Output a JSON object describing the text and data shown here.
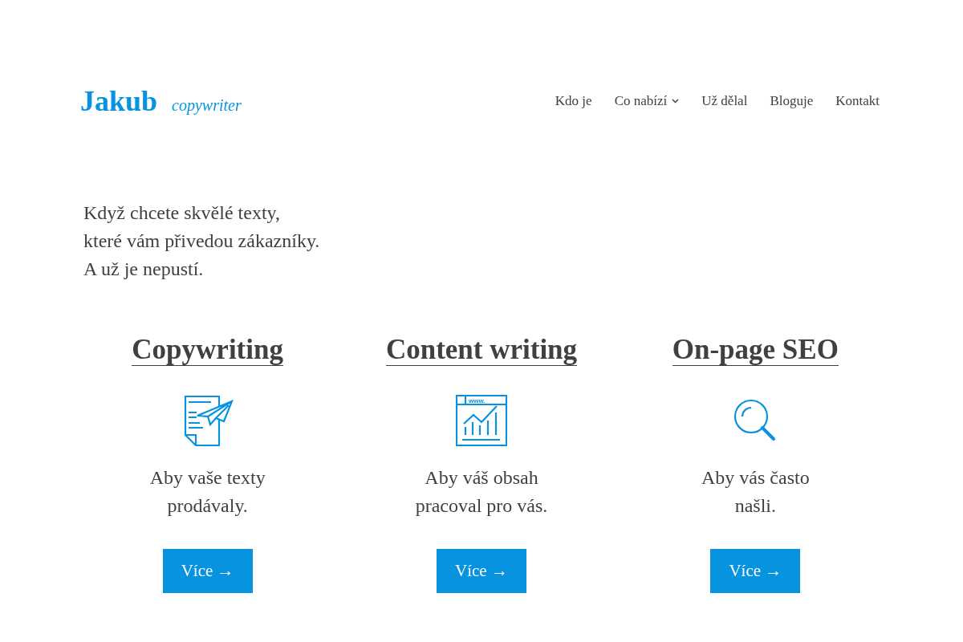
{
  "header": {
    "logo": "Jakub",
    "tagline": "copywriter",
    "nav": [
      {
        "label": "Kdo je",
        "has_dropdown": false
      },
      {
        "label": "Co nabízí",
        "has_dropdown": true
      },
      {
        "label": "Už dělal",
        "has_dropdown": false
      },
      {
        "label": "Bloguje",
        "has_dropdown": false
      },
      {
        "label": "Kontakt",
        "has_dropdown": false
      }
    ]
  },
  "hero": {
    "lines": [
      "Když chcete skvělé texty,",
      "které vám přivedou zákazníky.",
      "A už je nepustí."
    ]
  },
  "services": [
    {
      "title": "Copywriting",
      "kind": "document",
      "description": [
        "Aby vaše texty",
        "prodávaly."
      ],
      "button": "Více →"
    },
    {
      "title": "Content writing",
      "kind": "browser",
      "icon_text": "www.",
      "description": [
        "Aby váš obsah",
        "pracoval pro vás."
      ],
      "button": "Více →"
    },
    {
      "title": "On-page SEO",
      "kind": "search",
      "description": [
        "Aby vás často",
        "našli."
      ],
      "button": "Více →"
    }
  ]
}
